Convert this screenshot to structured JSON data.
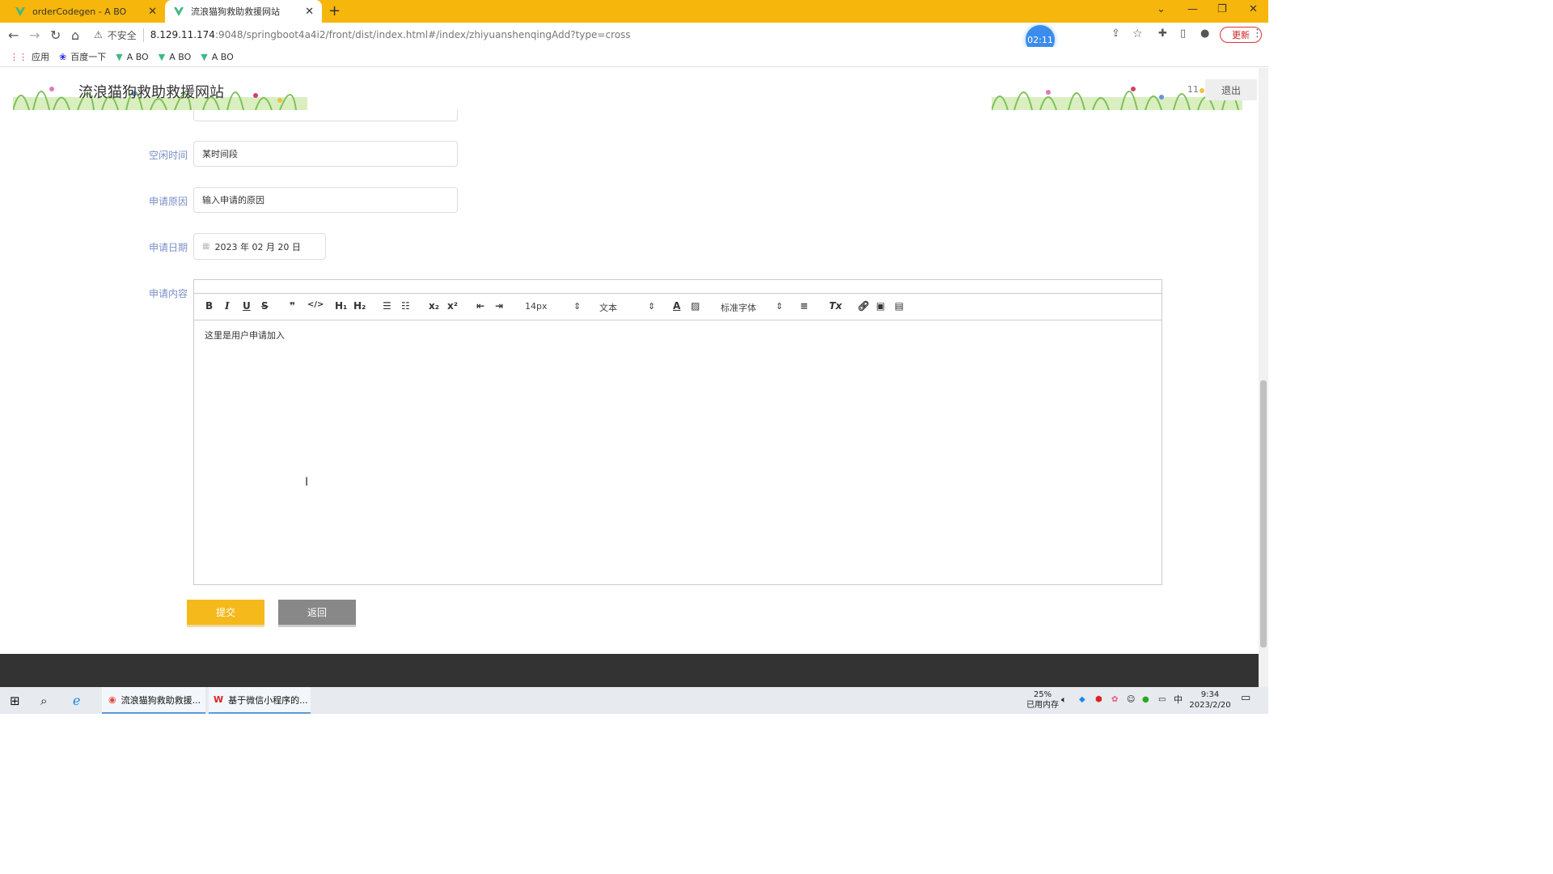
{
  "browser": {
    "tabs": [
      {
        "title": "orderCodegen - A BO",
        "active": false
      },
      {
        "title": "流浪猫狗救助救援网站",
        "active": true
      }
    ],
    "security_label": "不安全",
    "url_host": "8.129.11.174",
    "url_rest": ":9048/springboot4a4i2/front/dist/index.html#/index/zhiyuanshenqingAdd?type=cross",
    "timer": "02:11",
    "update_label": "更新",
    "bookmarks": [
      "应用",
      "百度一下",
      "A BO",
      "A BO",
      "A BO"
    ]
  },
  "site": {
    "title": "流浪猫狗救助救援网站",
    "logout_label": "退出",
    "user_initial": "11"
  },
  "form": {
    "idle_time": {
      "label": "空闲时间",
      "value": "某时间段"
    },
    "reason": {
      "label": "申请原因",
      "value": "输入申请的原因"
    },
    "date": {
      "label": "申请日期",
      "value": "2023 年 02 月 20 日"
    },
    "content": {
      "label": "申请内容",
      "value": "这里是用户申请加入"
    },
    "toolbar": {
      "font_size": "14px",
      "heading": "文本",
      "font_family": "标准字体"
    },
    "submit_label": "提交",
    "back_label": "返回"
  },
  "taskbar": {
    "items": [
      "流浪猫狗救助救援...",
      "基于微信小程序的..."
    ],
    "memory_pct": "25%",
    "memory_label": "已用内存",
    "ime": "中",
    "time": "9:34",
    "date": "2023/2/20"
  },
  "colors": {
    "accent": "#f7b60b",
    "label": "#7b8fc7",
    "footer": "#333333"
  }
}
